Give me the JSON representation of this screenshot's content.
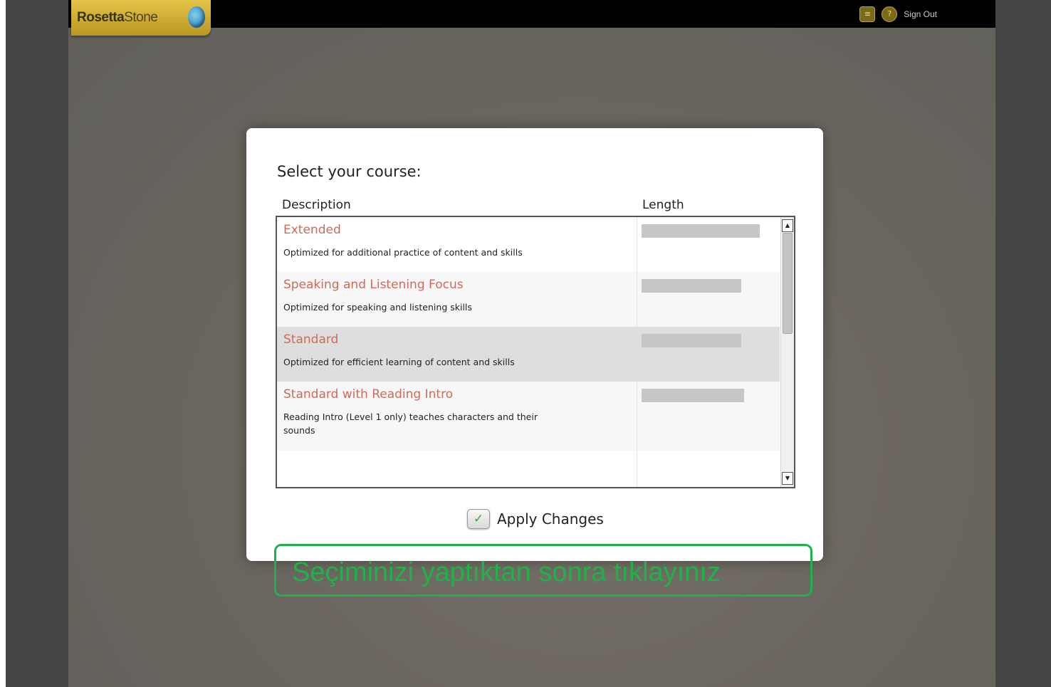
{
  "header": {
    "logo_text_bold": "Rosetta",
    "logo_text_light": "Stone",
    "sign_out_label": "Sign Out",
    "icons": [
      "settings-icon",
      "help-icon"
    ]
  },
  "dialog": {
    "title": "Select your course:",
    "columns": {
      "description": "Description",
      "length": "Length"
    },
    "courses": [
      {
        "name": "Extended",
        "description": "Optimized for additional practice of content and skills"
      },
      {
        "name": "Speaking and Listening Focus",
        "description": "Optimized for speaking and listening skills"
      },
      {
        "name": "Standard",
        "description": "Optimized for efficient learning of content and skills",
        "selected": true
      },
      {
        "name": "Standard with Reading Intro",
        "description": "Reading Intro (Level 1 only) teaches characters and their sounds"
      }
    ],
    "apply_label": "Apply Changes"
  },
  "annotation": {
    "text": "Seçiminizi yaptıktan sonra tıklayınız",
    "color": "#1fb24a"
  },
  "colors": {
    "course_name": "#d06a5a",
    "selected_row": "#dedede",
    "topbar": "#000000",
    "logo": "#d4b43a"
  }
}
